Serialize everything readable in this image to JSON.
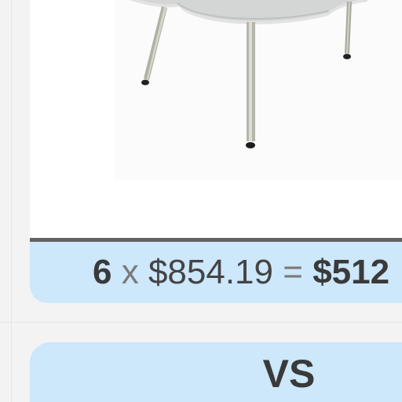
{
  "product": {
    "image_alt": "table",
    "quantity": "6",
    "times_sign": "x",
    "unit_price": "$854.19",
    "equals_sign": "=",
    "total_price": "$512"
  },
  "comparison": {
    "vs_label": "VS"
  }
}
